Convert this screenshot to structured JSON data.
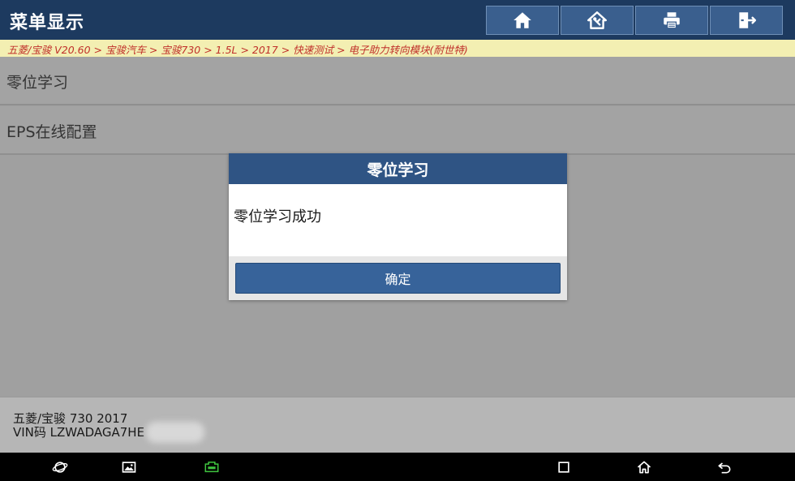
{
  "header": {
    "title": "菜单显示",
    "buttons": [
      {
        "icon": "home-icon"
      },
      {
        "icon": "diagnose-home-icon"
      },
      {
        "icon": "printer-icon"
      },
      {
        "icon": "exit-icon"
      }
    ]
  },
  "breadcrumb": "五菱/宝骏 V20.60 > 宝骏汽车 > 宝骏730 > 1.5L > 2017 > 快速测试 > 电子助力转向模块(耐世特)",
  "menu": {
    "items": [
      {
        "label": "零位学习"
      },
      {
        "label": "EPS在线配置"
      }
    ]
  },
  "dialog": {
    "title": "零位学习",
    "message": "零位学习成功",
    "ok_label": "确定"
  },
  "footer": {
    "vehicle": "五菱/宝骏 730 2017",
    "vin": "VIN码 LZWADAGA7HE"
  },
  "navbar": {
    "icons": [
      "browser-icon",
      "gallery-icon",
      "vci-icon",
      "recent-apps-icon",
      "home-icon",
      "back-icon"
    ]
  },
  "colors": {
    "header_bg": "#1d3a5f",
    "breadcrumb_bg": "#f3efb2",
    "breadcrumb_text": "#c0302a",
    "dialog_header": "#2f5484",
    "ok_button": "#37639a",
    "vci_icon": "#3fc43f"
  }
}
